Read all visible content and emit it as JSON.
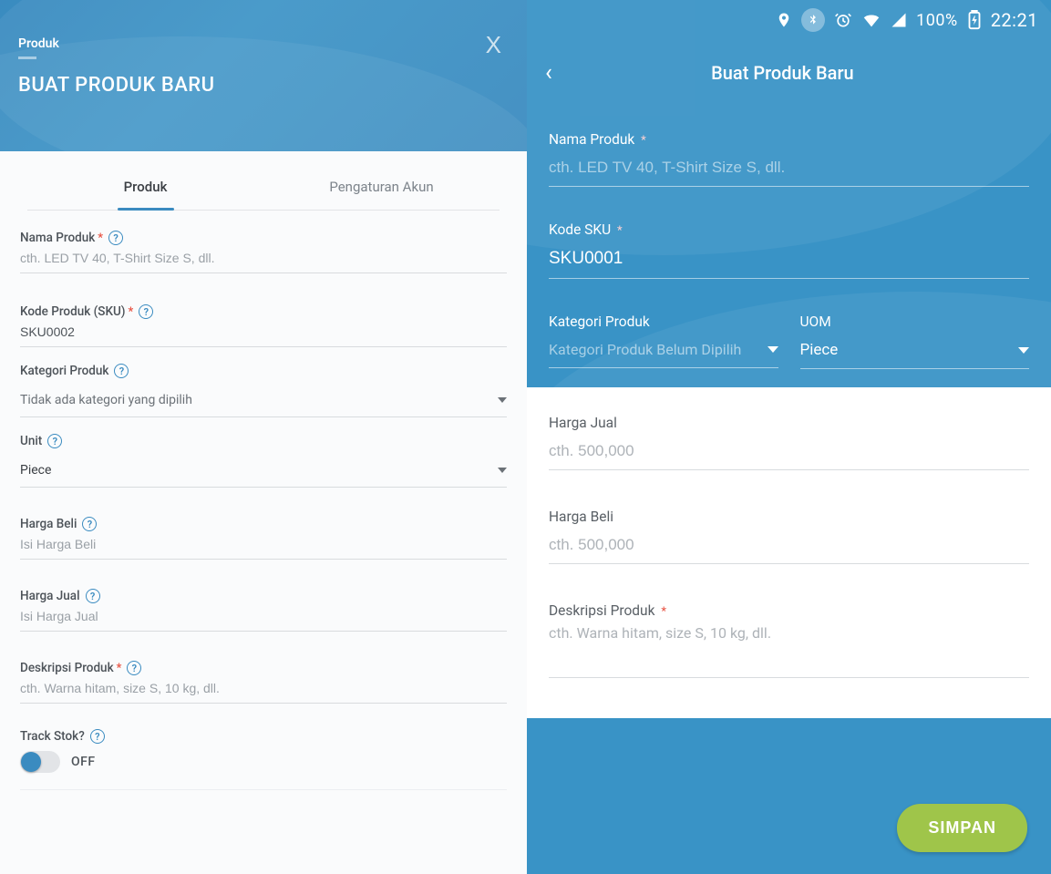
{
  "left": {
    "breadcrumb": "Produk",
    "title": "BUAT PRODUK BARU",
    "close_label": "X",
    "tabs": [
      {
        "label": "Produk",
        "active": true
      },
      {
        "label": "Pengaturan Akun",
        "active": false
      }
    ],
    "fields": {
      "nama_produk_label": "Nama Produk",
      "nama_produk_placeholder": "cth. LED TV 40, T-Shirt Size S, dll.",
      "kode_sku_label": "Kode Produk (SKU)",
      "kode_sku_value": "SKU0002",
      "kategori_label": "Kategori Produk",
      "kategori_selected": "Tidak ada kategori yang dipilih",
      "unit_label": "Unit",
      "unit_selected": "Piece",
      "harga_beli_label": "Harga Beli",
      "harga_beli_placeholder": "Isi Harga Beli",
      "harga_jual_label": "Harga Jual",
      "harga_jual_placeholder": "Isi Harga Jual",
      "deskripsi_label": "Deskripsi Produk",
      "deskripsi_placeholder": "cth. Warna hitam, size S, 10 kg, dll.",
      "track_stok_label": "Track Stok?",
      "track_stok_value": "OFF"
    },
    "help_glyph": "?"
  },
  "right": {
    "status": {
      "battery_pct": "100%",
      "time": "22:21"
    },
    "header": {
      "title": "Buat Produk Baru",
      "back_glyph": "‹"
    },
    "fields": {
      "nama_produk_label": "Nama Produk",
      "nama_produk_placeholder": "cth. LED TV 40, T-Shirt Size S, dll.",
      "kode_sku_label": "Kode SKU",
      "kode_sku_value": "SKU0001",
      "kategori_label": "Kategori Produk",
      "kategori_placeholder": "Kategori Produk Belum Dipilih",
      "uom_label": "UOM",
      "uom_selected": "Piece",
      "harga_jual_label": "Harga Jual",
      "harga_jual_placeholder": "cth. 500,000",
      "harga_beli_label": "Harga Beli",
      "harga_beli_placeholder": "cth. 500,000",
      "deskripsi_label": "Deskripsi Produk",
      "deskripsi_placeholder": "cth. Warna hitam, size S, 10 kg, dll."
    },
    "footer": {
      "save_label": "SIMPAN"
    }
  }
}
